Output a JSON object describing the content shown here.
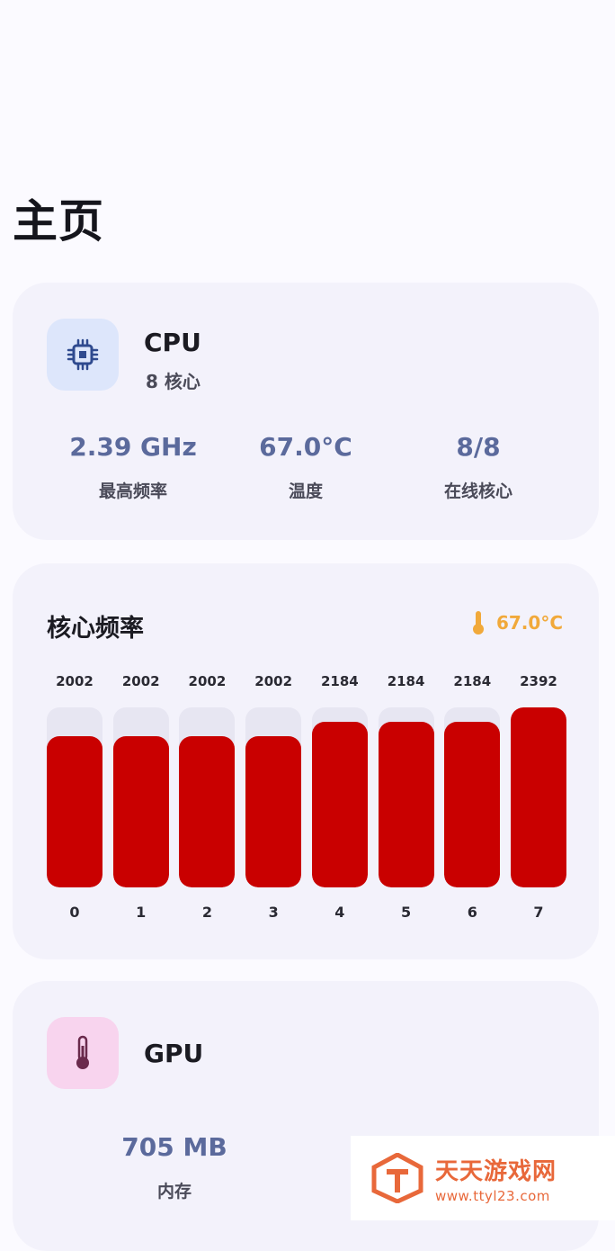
{
  "page": {
    "title": "主页"
  },
  "cpu": {
    "title": "CPU",
    "subtitle": "8 核心",
    "icon": "cpu-chip-icon",
    "stats": [
      {
        "value": "2.39 GHz",
        "label": "最高频率"
      },
      {
        "value": "67.0°C",
        "label": "温度"
      },
      {
        "value": "8/8",
        "label": "在线核心"
      }
    ]
  },
  "core_freq": {
    "title": "核心频率",
    "temp": "67.0°C",
    "temp_icon": "thermometer-icon",
    "bar_color": "#c90000",
    "cores": [
      {
        "index": "0",
        "value": "2002",
        "fill": 0.84
      },
      {
        "index": "1",
        "value": "2002",
        "fill": 0.84
      },
      {
        "index": "2",
        "value": "2002",
        "fill": 0.84
      },
      {
        "index": "3",
        "value": "2002",
        "fill": 0.84
      },
      {
        "index": "4",
        "value": "2184",
        "fill": 0.92
      },
      {
        "index": "5",
        "value": "2184",
        "fill": 0.92
      },
      {
        "index": "6",
        "value": "2184",
        "fill": 0.92
      },
      {
        "index": "7",
        "value": "2392",
        "fill": 1.0
      }
    ]
  },
  "gpu": {
    "title": "GPU",
    "icon": "thermometer-icon",
    "stats": [
      {
        "value": "705 MB",
        "label": "内存"
      }
    ]
  },
  "watermark": {
    "name": "天天游戏网",
    "url": "www.ttyl23.com"
  }
}
